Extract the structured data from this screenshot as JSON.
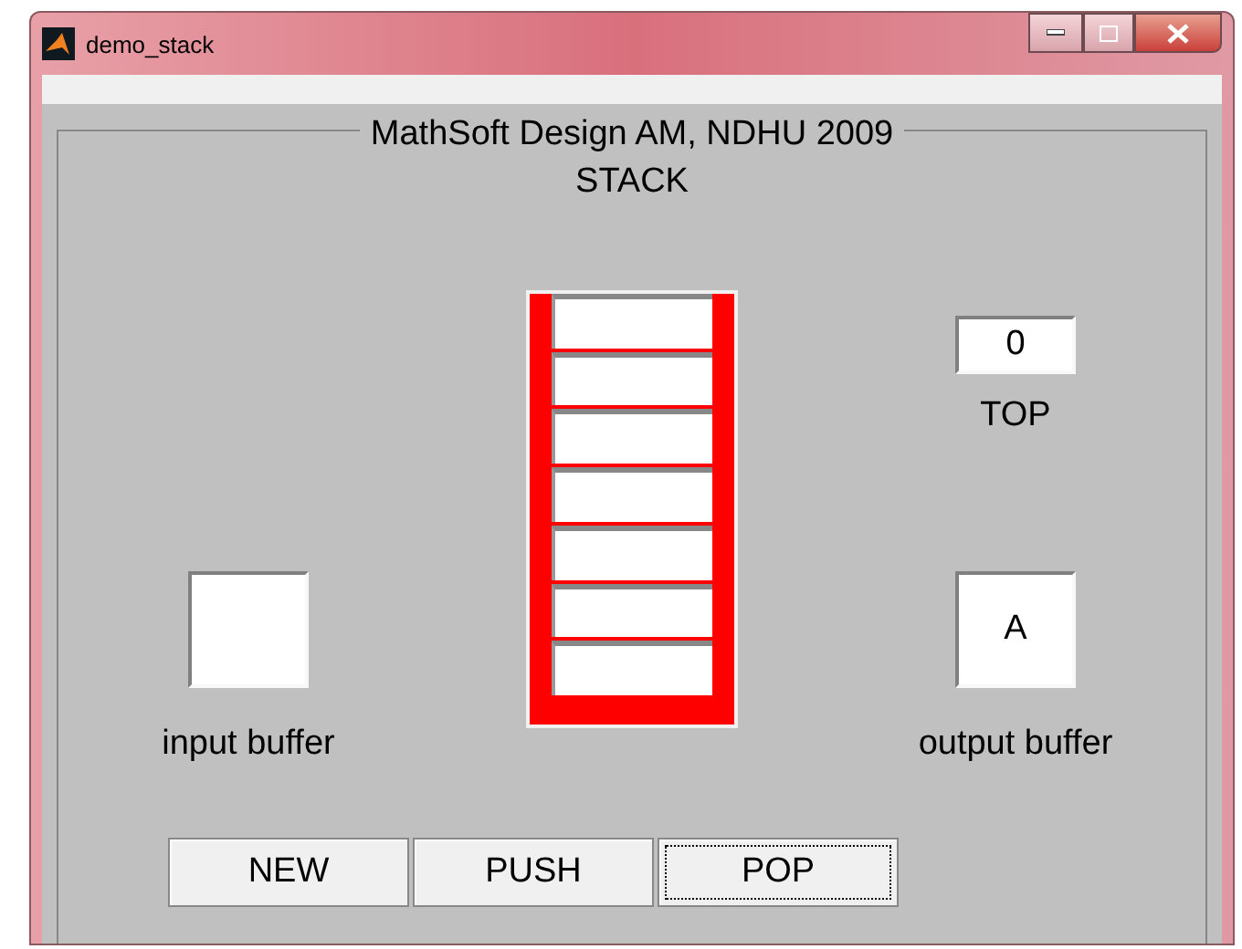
{
  "window": {
    "title": "demo_stack"
  },
  "panel": {
    "title": "MathSoft Design AM, NDHU 2009",
    "subtitle": "STACK"
  },
  "top": {
    "value": "0",
    "label": "TOP"
  },
  "input_buffer": {
    "label": "input buffer"
  },
  "output_buffer": {
    "value": "A",
    "label": "output buffer"
  },
  "buttons": [
    {
      "label": "NEW",
      "focused": false
    },
    {
      "label": "PUSH",
      "focused": false
    },
    {
      "label": "POP",
      "focused": true
    }
  ]
}
